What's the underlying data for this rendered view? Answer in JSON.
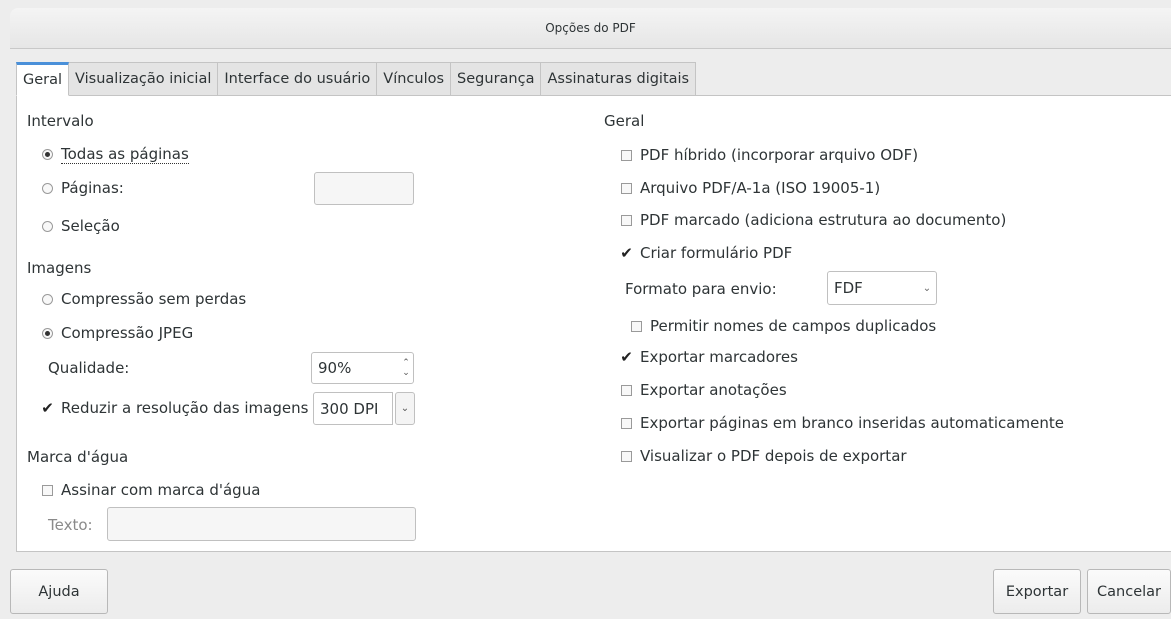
{
  "window": {
    "title": "Opções do PDF"
  },
  "tabs": [
    {
      "label": "Geral",
      "active": true
    },
    {
      "label": "Visualização inicial"
    },
    {
      "label": "Interface do usuário"
    },
    {
      "label": "Vínculos"
    },
    {
      "label": "Segurança"
    },
    {
      "label": "Assinaturas digitais"
    }
  ],
  "range": {
    "heading": "Intervalo",
    "all_pages": {
      "label": "Todas as páginas",
      "selected": true
    },
    "pages": {
      "label": "Páginas:",
      "value": ""
    },
    "selection": {
      "label": "Seleção"
    }
  },
  "images": {
    "heading": "Imagens",
    "lossless": {
      "label": "Compressão sem perdas"
    },
    "jpeg": {
      "label": "Compressão JPEG",
      "selected": true
    },
    "quality": {
      "label": "Qualidade:",
      "value": "90%"
    },
    "reduce": {
      "label": "Reduzir a resolução das imagens",
      "checked": true,
      "value": "300 DPI"
    }
  },
  "watermark": {
    "heading": "Marca d'água",
    "sign": {
      "label": "Assinar com marca d'água",
      "checked": false
    },
    "text": {
      "label": "Texto:",
      "value": ""
    }
  },
  "general": {
    "heading": "Geral",
    "hybrid": {
      "label": "PDF híbrido (incorporar arquivo ODF)",
      "checked": false
    },
    "archive": {
      "label": "Arquivo PDF/A-1a (ISO 19005-1)",
      "checked": false
    },
    "tagged": {
      "label": "PDF marcado (adiciona estrutura ao documento)",
      "checked": false
    },
    "form": {
      "label": "Criar formulário PDF",
      "checked": true
    },
    "submit_format": {
      "label": "Formato para envio:",
      "value": "FDF"
    },
    "duplicate_fields": {
      "label": "Permitir nomes de campos duplicados",
      "checked": false
    },
    "bookmarks": {
      "label": "Exportar marcadores",
      "checked": true
    },
    "comments": {
      "label": "Exportar anotações",
      "checked": false
    },
    "blank_pages": {
      "label": "Exportar páginas em branco inseridas automaticamente",
      "checked": false
    },
    "view_after": {
      "label": "Visualizar o PDF depois de exportar",
      "checked": false
    }
  },
  "buttons": {
    "help": "Ajuda",
    "export": "Exportar",
    "cancel": "Cancelar"
  }
}
